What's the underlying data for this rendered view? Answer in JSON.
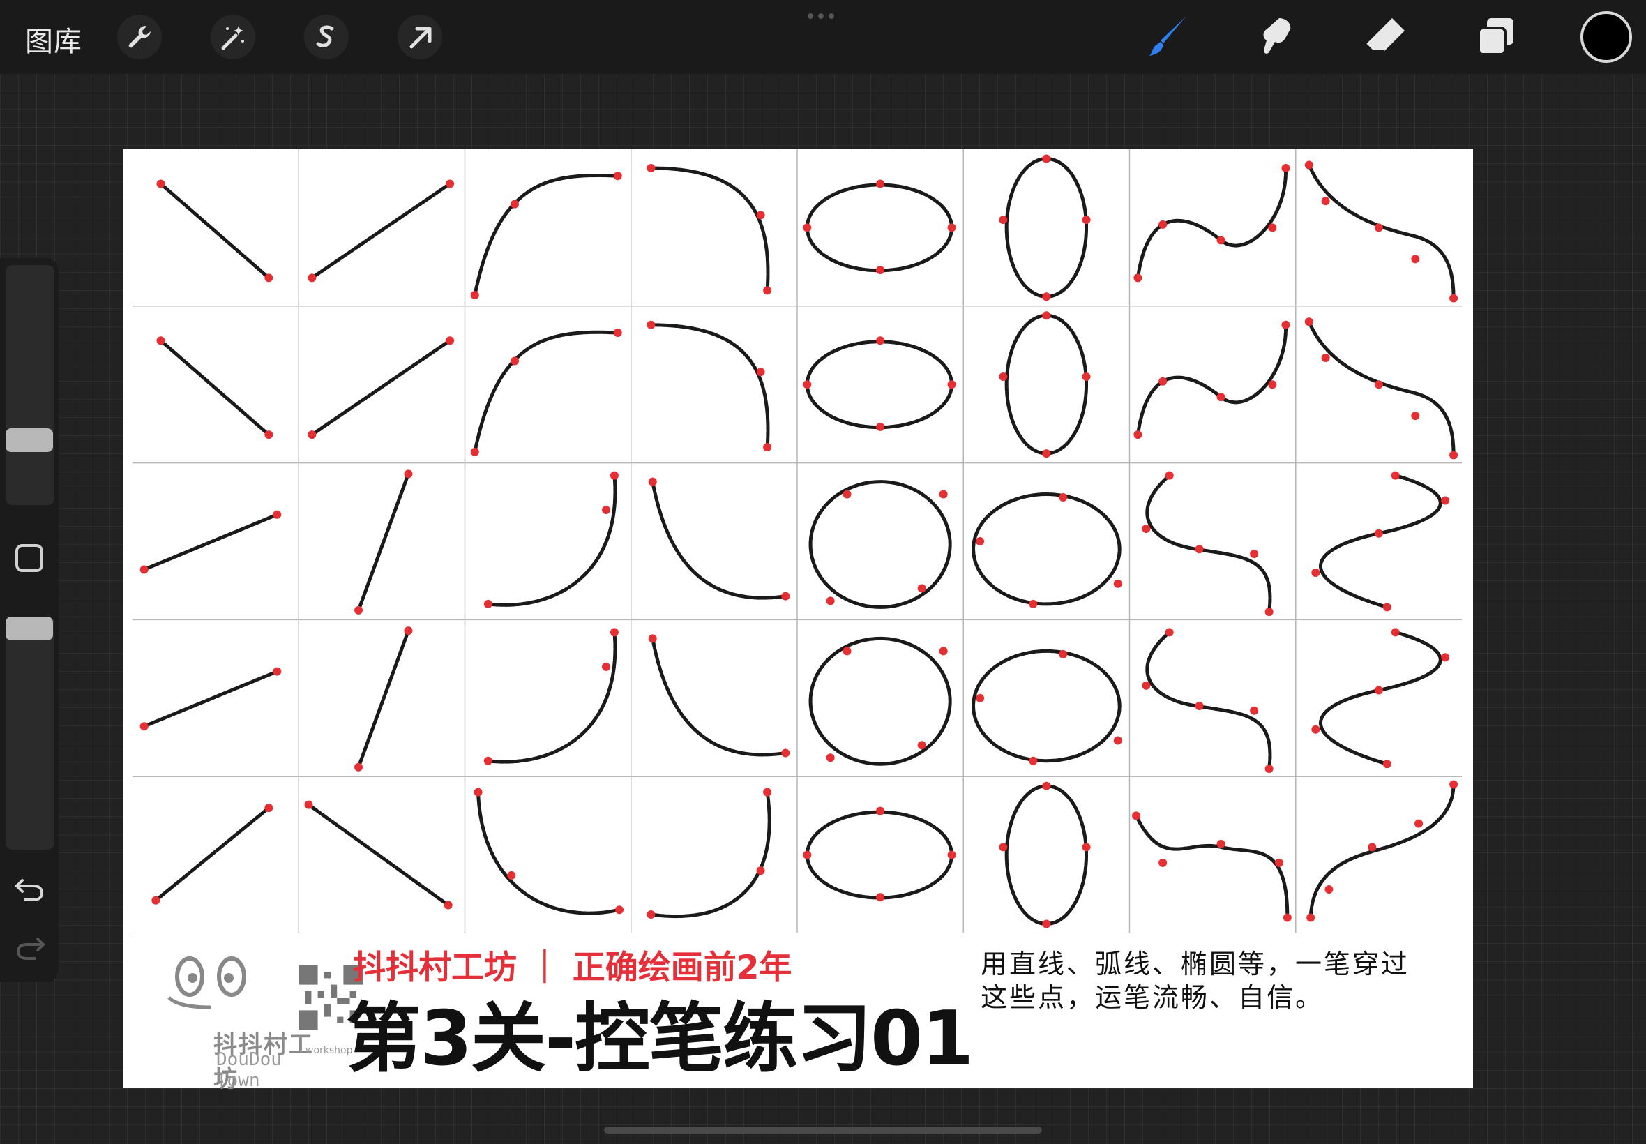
{
  "topbar": {
    "gallery_label": "图库",
    "left_tools": [
      "wrench-icon",
      "magic-wand-icon",
      "selection-icon",
      "transform-arrow-icon"
    ],
    "right_tools": [
      "brush-icon",
      "smudge-icon",
      "eraser-icon",
      "layers-icon"
    ],
    "active_tool": "brush-icon",
    "accent_color": "#2f7ff0",
    "current_color": "#000000"
  },
  "sidebar": {
    "brush_size_level": 0.45,
    "opacity_level": 0.5
  },
  "canvas": {
    "grid_rows": 5,
    "grid_cols": 8,
    "stroke_color": "#1a1a1a",
    "point_color": "#e52f33",
    "footer": {
      "subtitle": "抖抖村工坊 ｜ 正确绘画前2年",
      "title": "第3关-控笔练习01",
      "instruction": "用直线、弧线、椭圆等，一笔穿过这些点，运笔流畅、自信。",
      "logo": {
        "chinese": "抖抖村工坊",
        "english": "DouDou Town",
        "workshop": "workshop"
      }
    }
  }
}
